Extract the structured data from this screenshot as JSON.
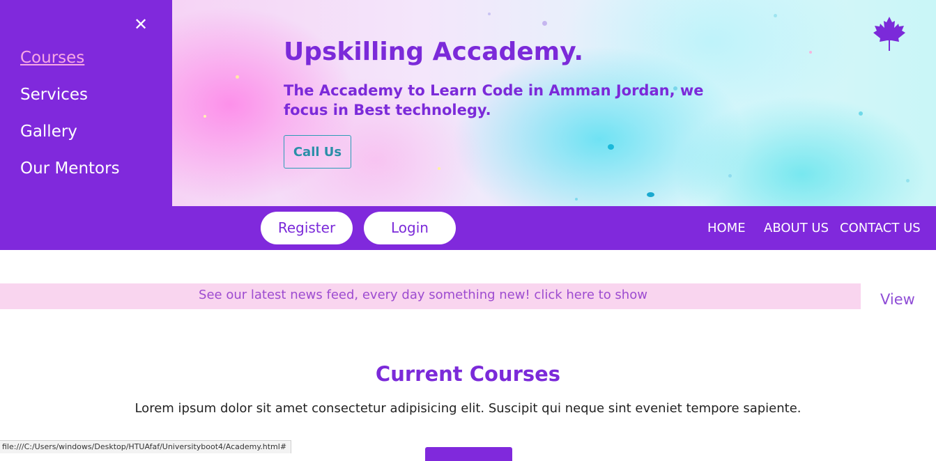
{
  "side_menu": {
    "close_glyph": "✕",
    "items": [
      {
        "label": "Courses",
        "active": true
      },
      {
        "label": "Services"
      },
      {
        "label": "Gallery"
      },
      {
        "label": "Our Mentors"
      }
    ]
  },
  "hero": {
    "title": "Upskilling Accademy.",
    "subtitle": "The Accademy to Learn Code in Amman Jordan, we focus in Best technolegy.",
    "cta_label": "Call Us",
    "logo_icon": "maple-leaf-icon"
  },
  "navbar": {
    "register_label": "Register",
    "login_label": "Login",
    "links": [
      "HOME",
      "ABOUT US",
      "CONTACT US"
    ]
  },
  "news": {
    "text": "See our latest news feed, every day something new! click here to show",
    "view_label": "View"
  },
  "courses": {
    "title": "Current Courses",
    "description": "Lorem ipsum dolor sit amet consectetur adipisicing elit. Suscipit qui neque sint eveniet tempore sapiente."
  },
  "status_bar": {
    "url": "file:///C:/Users/windows/Desktop/HTUAfaf/Universityboot4/Academy.html#"
  },
  "colors": {
    "brand_purple": "#8029dc",
    "title_purple": "#7b2ad9",
    "cta_teal": "#2a8fa8",
    "news_pink": "#f9d5ef",
    "active_link_pink": "#f8a8e4"
  }
}
